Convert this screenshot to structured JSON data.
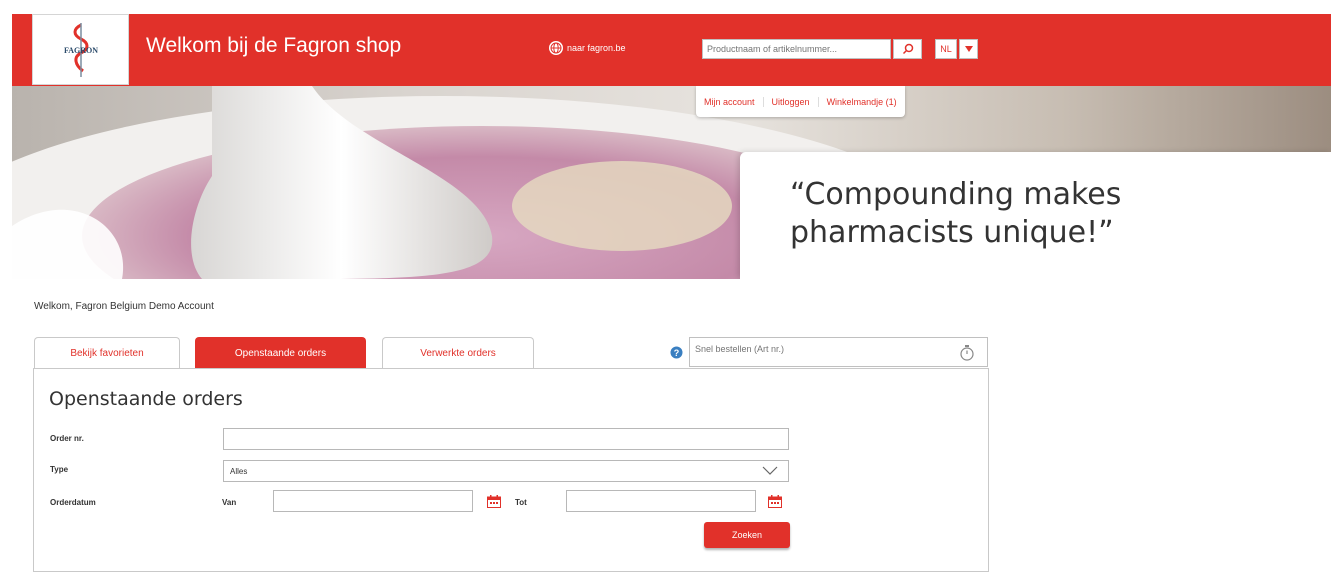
{
  "header": {
    "shop_title": "Welkom bij de Fagron shop",
    "logo_text": "FAGRON",
    "fagron_link": "naar fagron.be",
    "search_placeholder": "Productnaam of artikelnummer...",
    "lang": "NL",
    "brand_color": "#e1312a"
  },
  "account_nav": {
    "my_account": "Mijn account",
    "logout": "Uitloggen",
    "cart": "Winkelmandje (1)"
  },
  "banner": {
    "quote": "“Compounding makes pharmacists unique!”"
  },
  "welcome_text": "Welkom, Fagron Belgium Demo Account",
  "tabs": [
    {
      "label": "Bekijk favorieten",
      "active": false
    },
    {
      "label": "Openstaande orders",
      "active": true
    },
    {
      "label": "Verwerkte orders",
      "active": false
    }
  ],
  "quick_order": {
    "placeholder": "Snel bestellen (Art nr.)"
  },
  "panel": {
    "title": "Openstaande orders",
    "order_nr_label": "Order nr.",
    "order_nr_value": "",
    "type_label": "Type",
    "type_value": "Alles",
    "date_label": "Orderdatum",
    "from_label": "Van",
    "to_label": "Tot",
    "search_button": "Zoeken"
  },
  "icons": [
    "globe-icon",
    "search-icon",
    "dropdown-arrow-icon",
    "help-icon",
    "stopwatch-icon",
    "chevron-down-icon",
    "calendar-icon"
  ]
}
